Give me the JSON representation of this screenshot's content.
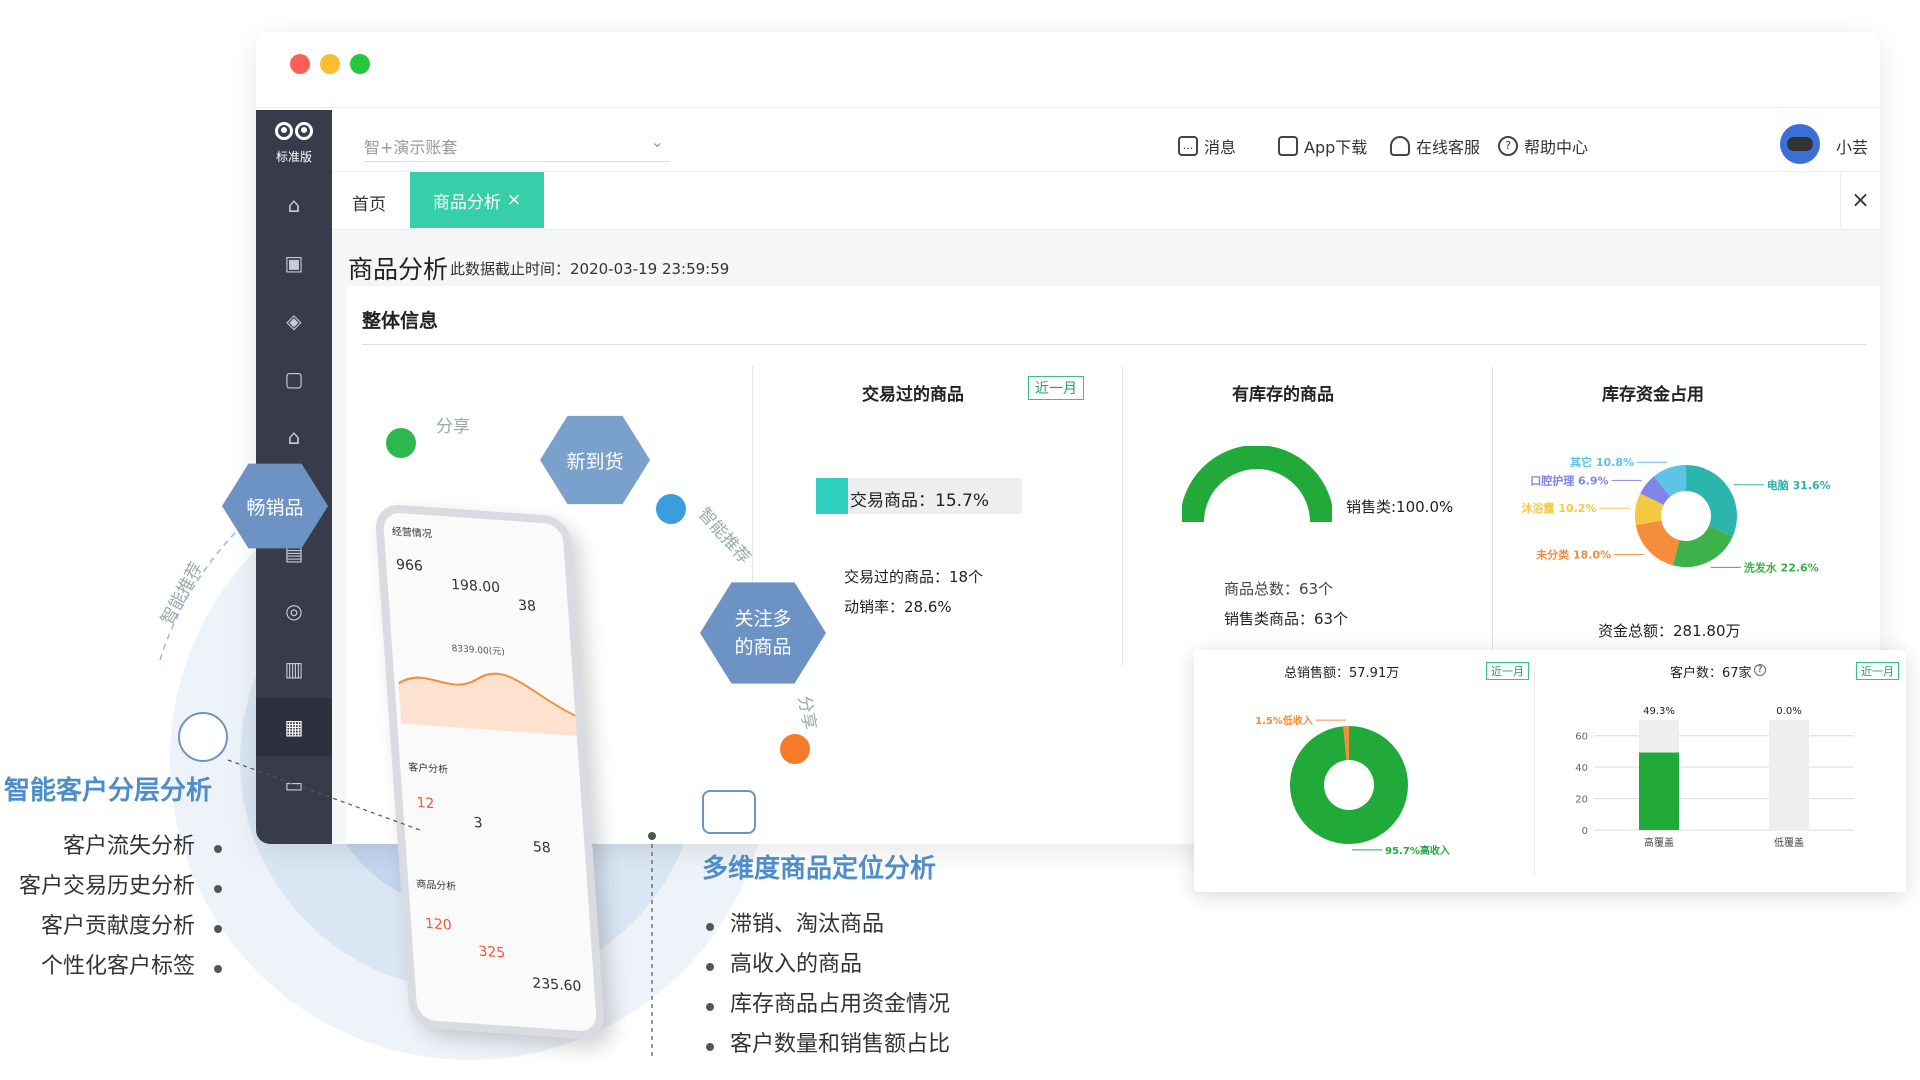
{
  "window": {
    "account_select": "智+演示账套",
    "logo_label": "标准版",
    "top_nav": {
      "messages": "消息",
      "app_download": "App下载",
      "online_service": "在线客服",
      "help_center": "帮助中心",
      "user_name": "小芸"
    },
    "tabs": {
      "home": "首页",
      "active": "商品分析"
    }
  },
  "page": {
    "title": "商品分析",
    "data_cutoff": "此数据截止时间：2020-03-19 23:59:59",
    "overall_title": "整体信息",
    "traded": {
      "title": "交易过的商品",
      "badge": "近一月",
      "bar_label": "交易商品：15.7%",
      "bar_fraction": 0.157,
      "count_line": "交易过的商品：18个",
      "rate_line": "动销率：28.6%"
    },
    "stocked": {
      "title": "有库存的商品",
      "gauge_label": "销售类:100.0%",
      "gauge_fraction": 1.0,
      "total_line": "商品总数：63个",
      "sales_line": "销售类商品：63个"
    },
    "capital": {
      "title": "库存资金占用",
      "total_line": "资金总额：281.80万",
      "slices": [
        {
          "label": "电脑 31.6%",
          "value": 31.6,
          "color": "#2bb5ad"
        },
        {
          "label": "洗发水 22.6%",
          "value": 22.6,
          "color": "#3db24a"
        },
        {
          "label": "未分类 18.0%",
          "value": 18.0,
          "color": "#f58d3b"
        },
        {
          "label": "沐浴露 10.2%",
          "value": 10.2,
          "color": "#f5c842"
        },
        {
          "label": "口腔护理 6.9%",
          "value": 6.9,
          "color": "#7f86e8"
        },
        {
          "label": "其它 10.8%",
          "value": 10.8,
          "color": "#5dc4e8"
        }
      ]
    }
  },
  "float_card": {
    "sales": {
      "title": "总销售额：57.91万",
      "badge": "近一月",
      "slices": [
        {
          "label": "95.7%高收入",
          "value": 95.7,
          "color": "#21aa3a"
        },
        {
          "label": "1.5%低收入",
          "value": 1.5,
          "color": "#f58d3b"
        }
      ]
    },
    "customers": {
      "title": "客户数：67家",
      "badge": "近一月",
      "chart_data": {
        "type": "bar",
        "categories": [
          "高覆盖",
          "低覆盖"
        ],
        "values": [
          49.3,
          0.0
        ],
        "value_labels": [
          "49.3%",
          "0.0%"
        ],
        "ylim": [
          0,
          70
        ],
        "yticks": [
          "60",
          "40",
          "20",
          "0"
        ]
      }
    }
  },
  "phone": {
    "header": "经营情况",
    "n1": "966",
    "n2": "198.00",
    "n3": "38",
    "chart_value": "8339.00(元)",
    "section1": "客户分析",
    "c1": "12",
    "c2": "3",
    "c3": "58",
    "section2": "商品分析",
    "p1": "120",
    "p2": "325",
    "p3": "235.60"
  },
  "diagram": {
    "hex_new": "新到货",
    "hex_hot": "畅销品",
    "hex_follow": "关注多的商品",
    "arc_share1": "分享",
    "arc_smart1": "智能推荐",
    "arc_smart2": "智能推荐",
    "arc_share2": "分享",
    "left_title": "智能客户分层分析",
    "left_items": [
      "客户流失分析",
      "客户交易历史分析",
      "客户贡献度分析",
      "个性化客户标签"
    ],
    "right_title": "多维度商品定位分析",
    "right_items": [
      "滞销、淘汰商品",
      "高收入的商品",
      "库存商品占用资金情况",
      "客户数量和销售额占比"
    ]
  }
}
